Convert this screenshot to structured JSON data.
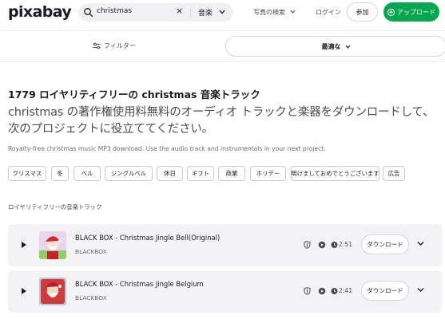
{
  "header": {
    "logo": "pixabay",
    "search": {
      "value": "christmas",
      "clear": "×",
      "type": "音楽"
    },
    "nav": {
      "explore": "写真の検索",
      "login": "ログイン",
      "join": "参加",
      "upload": "アップロード"
    }
  },
  "filterbar": {
    "filter": "フィルター",
    "sort": "最適な"
  },
  "content": {
    "heading": "1779 ロイヤリティフリーの christmas 音楽トラック",
    "subheading": "christmas の著作権使用料無料のオーディオ トラックと楽器をダウンロードして、次のプロジェクトに役立ててください。",
    "description": "Royalty-free christmas music MP3 download. Use the audio track and instrumentals in your next project.",
    "tags": [
      "クリスマス",
      "冬",
      "ベル",
      "ジングルベル",
      "休日",
      "ギフト",
      "商業",
      "ホリデー",
      "明けましておめでとうございます",
      "広告"
    ],
    "section_label": "ロイヤリティフリーの音楽トラック"
  },
  "tracks": [
    {
      "title": "BLACK BOX - Christmas Jingle Bell(Original)",
      "artist": "BLACKBOX",
      "duration": "2:51",
      "download": "ダウンロード"
    },
    {
      "title": "BLACK BOX - Christmas Jingle Belgium",
      "artist": "BLACKBOX",
      "duration": "2:41",
      "download": "ダウンロード"
    }
  ],
  "colors": {
    "accent": "#07a74f",
    "text": "#191b26",
    "muted": "#6b6d78",
    "track_bg": "#f3f3f5"
  }
}
